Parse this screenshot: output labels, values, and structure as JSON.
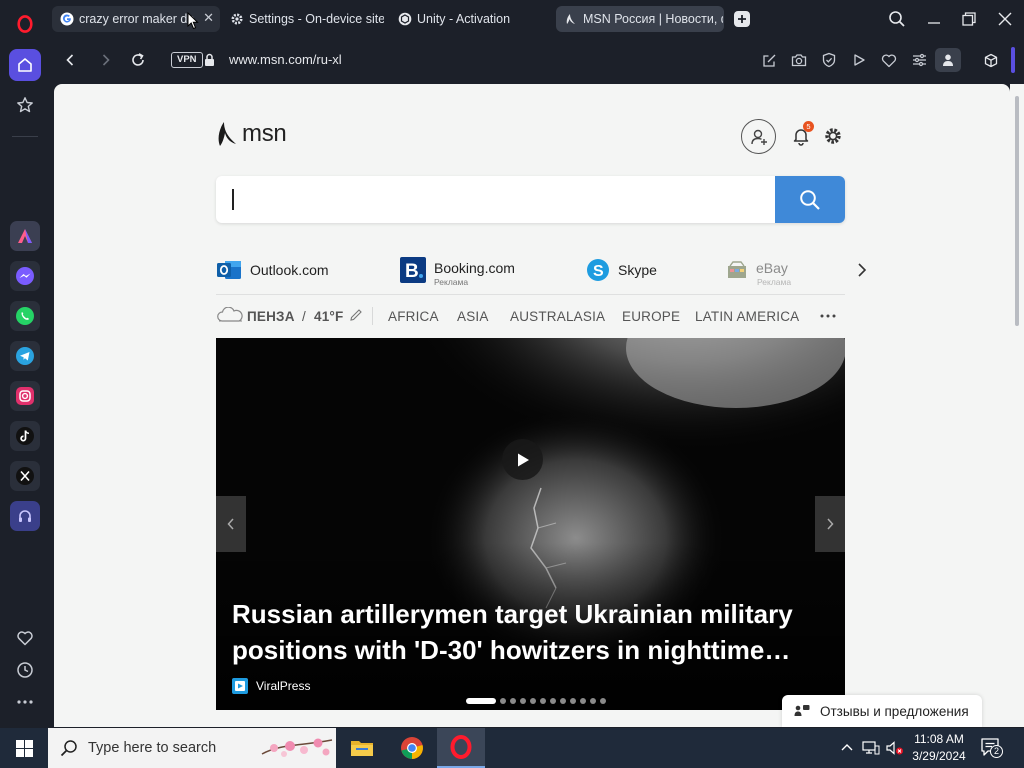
{
  "tabs": [
    {
      "title": "crazy error maker do",
      "favicon": "google-icon",
      "active": false
    },
    {
      "title": "Settings - On-device site c",
      "favicon": "gear-icon",
      "active": false
    },
    {
      "title": "Unity - Activation",
      "favicon": "unity-icon",
      "active": false
    },
    {
      "title": "MSN Россия | Новости, ф",
      "favicon": "msn-icon",
      "active": true
    }
  ],
  "address_bar": {
    "vpn_label": "VPN",
    "url": "www.msn.com/ru-xl"
  },
  "msn": {
    "logo_text": "msn",
    "notification_count": "5",
    "search": {
      "value": "",
      "placeholder": ""
    },
    "quick_links": [
      {
        "label": "Outlook.com",
        "sub": "",
        "icon": "outlook-icon"
      },
      {
        "label": "Booking.com",
        "sub": "Реклама",
        "icon": "booking-icon"
      },
      {
        "label": "Skype",
        "sub": "",
        "icon": "skype-icon"
      },
      {
        "label": "eBay",
        "sub": "Реклама",
        "icon": "ebay-icon"
      }
    ],
    "weather": {
      "city": "ПЕНЗА",
      "temp": "41°F",
      "icon": "cloud-icon"
    },
    "regions": [
      "AFRICA",
      "ASIA",
      "AUSTRALASIA",
      "EUROPE",
      "LATIN AMERICA"
    ],
    "hero": {
      "headline": "Russian artillerymen target Ukrainian military positions with 'D-30' howitzers in nighttime…",
      "source": "ViralPress",
      "slides_total": 12,
      "slide_active": 1
    },
    "feedback_label": "Отзывы и предложения"
  },
  "taskbar": {
    "search_placeholder": "Type here to search",
    "time": "11:08 AM",
    "date": "3/29/2024",
    "notification_count": "2"
  },
  "colors": {
    "msn_blue": "#3f89d8",
    "browser_bg": "#1c2029",
    "opera_red": "#ff1b2d"
  }
}
